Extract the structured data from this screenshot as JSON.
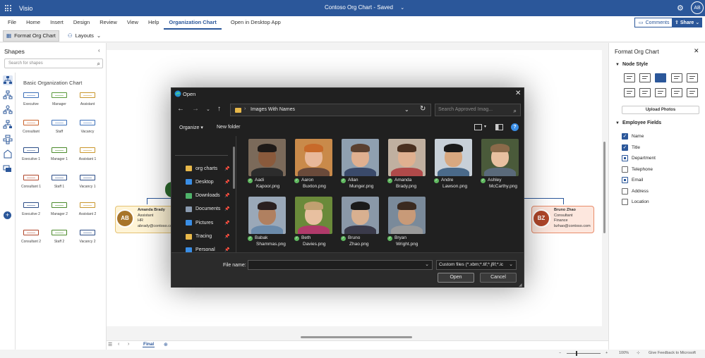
{
  "app": {
    "name": "Visio",
    "doc_title": "Contoso Org Chart",
    "doc_status": "Saved",
    "user_initials": "AB"
  },
  "ribbon": {
    "tabs": [
      "File",
      "Home",
      "Insert",
      "Design",
      "Review",
      "View",
      "Help",
      "Organization Chart",
      "Open in Desktop App"
    ],
    "active_tab": "Organization Chart",
    "comments_label": "Comments",
    "share_label": "Share"
  },
  "toolbar": {
    "format_org_chart": "Format Org Chart",
    "layouts": "Layouts"
  },
  "shapes_pane": {
    "title": "Shapes",
    "search_placeholder": "Search for shapes",
    "stencil_name": "Basic Organization Chart",
    "shapes": [
      {
        "label": "Executive",
        "color": "#3b6fb8"
      },
      {
        "label": "Manager",
        "color": "#5a9a3a"
      },
      {
        "label": "Assistant",
        "color": "#c9962b"
      },
      {
        "label": "Consultant",
        "color": "#c9622b"
      },
      {
        "label": "Staff",
        "color": "#3b6fb8"
      },
      {
        "label": "Vacancy",
        "color": "#3b6fb8"
      },
      {
        "label": "Executive 1",
        "color": "#2b4c86"
      },
      {
        "label": "Manager 1",
        "color": "#4a8a2a"
      },
      {
        "label": "Assistant 1",
        "color": "#c9962b"
      },
      {
        "label": "Consultant 1",
        "color": "#b0462a"
      },
      {
        "label": "Staff 1",
        "color": "#2b4c86"
      },
      {
        "label": "Vacancy 1",
        "color": "#2b4c86"
      },
      {
        "label": "Executive 2",
        "color": "#2b4c86"
      },
      {
        "label": "Manager 2",
        "color": "#4a8a2a"
      },
      {
        "label": "Assistant 2",
        "color": "#c9962b"
      },
      {
        "label": "Consultant 2",
        "color": "#b0462a"
      },
      {
        "label": "Staff 2",
        "color": "#4a8a2a"
      },
      {
        "label": "Vacancy 2",
        "color": "#2b4c86"
      }
    ]
  },
  "canvas": {
    "left_card": {
      "initials": "AB",
      "name": "Amanda Brady",
      "title": "Assistant",
      "department": "HR",
      "email": "abrady@contoso.com"
    },
    "right_card": {
      "initials": "BZ",
      "name": "Bruno Zhao",
      "title": "Consultant",
      "department": "Finance",
      "email": "bzhao@contoso.com"
    },
    "sheet_tab": "Final"
  },
  "statusbar": {
    "zoom": "100%",
    "feedback": "Give Feedback to Microsoft"
  },
  "format_pane": {
    "title": "Format Org Chart",
    "node_style_heading": "Node Style",
    "upload_photos": "Upload Photos",
    "employee_fields_heading": "Employee Fields",
    "fields": [
      {
        "label": "Name",
        "state": "checked"
      },
      {
        "label": "Title",
        "state": "checked"
      },
      {
        "label": "Department",
        "state": "partial"
      },
      {
        "label": "Telephone",
        "state": "unchecked"
      },
      {
        "label": "Email",
        "state": "partial"
      },
      {
        "label": "Address",
        "state": "unchecked"
      },
      {
        "label": "Location",
        "state": "unchecked"
      }
    ]
  },
  "open_dialog": {
    "title": "Open",
    "path": "Images With Names",
    "search_placeholder": "Search Approved Imag...",
    "organize": "Organize",
    "new_folder": "New folder",
    "nav_items": [
      {
        "label": "org charts",
        "icon": "folder-icon",
        "color": "#e8b84a"
      },
      {
        "label": "Desktop",
        "icon": "desktop-icon",
        "color": "#3a8ee6"
      },
      {
        "label": "Downloads",
        "icon": "download-icon",
        "color": "#4fb36a"
      },
      {
        "label": "Documents",
        "icon": "documents-icon",
        "color": "#8a9bb0"
      },
      {
        "label": "Pictures",
        "icon": "pictures-icon",
        "color": "#3a8ee6"
      },
      {
        "label": "Tracing",
        "icon": "folder-icon",
        "color": "#e8b84a"
      },
      {
        "label": "Personal",
        "icon": "person-icon",
        "color": "#3a8ee6"
      }
    ],
    "files": [
      {
        "line1": "Aadi",
        "line2": "Kapoor.png",
        "bg": "#7b6a5a",
        "skin": "#8a5a3c",
        "hair": "#1e1a18",
        "shirt": "#2c2c2c"
      },
      {
        "line1": "Aaron",
        "line2": "Buxton.png",
        "bg": "#c98a4a",
        "skin": "#e8b89a",
        "hair": "#c86a2a",
        "shirt": "#6a4a3a"
      },
      {
        "line1": "Allan",
        "line2": "Munger.png",
        "bg": "#8fa0b0",
        "skin": "#e0b090",
        "hair": "#5a4030",
        "shirt": "#3a4a6a"
      },
      {
        "line1": "Amanda",
        "line2": "Brady.png",
        "bg": "#c0b0a0",
        "skin": "#e0b090",
        "hair": "#4a3020",
        "shirt": "#b04a4a"
      },
      {
        "line1": "Andre",
        "line2": "Lawson.png",
        "bg": "#c8d0d8",
        "skin": "#d8a880",
        "hair": "#1a1a1a",
        "shirt": "#4a6a8a"
      },
      {
        "line1": "Ashley",
        "line2": "McCarthy.png",
        "bg": "#4a5a3a",
        "skin": "#e8c0a0",
        "hair": "#8a6a4a",
        "shirt": "#5a6a7a"
      },
      {
        "line1": "Babak",
        "line2": "Shammas.png",
        "bg": "#9aa8b8",
        "skin": "#b08060",
        "hair": "#2a2020",
        "shirt": "#6a8aaa"
      },
      {
        "line1": "Beth",
        "line2": "Davies.png",
        "bg": "#6a8a3a",
        "skin": "#e8c0a0",
        "hair": "#c0a070",
        "shirt": "#b03a6a"
      },
      {
        "line1": "Bruno",
        "line2": "Zhao.png",
        "bg": "#8a98a8",
        "skin": "#d8b090",
        "hair": "#1a1a1a",
        "shirt": "#3a3a4a"
      },
      {
        "line1": "Bryan",
        "line2": "Wright.png",
        "bg": "#7a8a9a",
        "skin": "#c89a78",
        "hair": "#3a2a20",
        "shirt": "#9a9a9a"
      }
    ],
    "file_name_label": "File name:",
    "file_name_value": "",
    "filter": "Custom files (*.xbm;*.tif;*.jfif;*.ic",
    "open_button": "Open",
    "cancel_button": "Cancel"
  }
}
